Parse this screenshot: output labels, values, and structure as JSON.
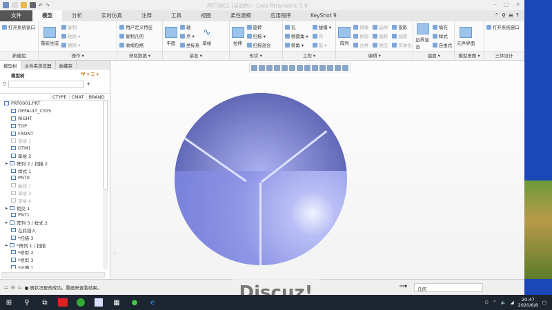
{
  "window": {
    "title": "PRT0001 (活动的) - Creo Parametric 5.0"
  },
  "tabs": [
    "文件",
    "模型",
    "分析",
    "实时仿真",
    "注释",
    "工具",
    "视图",
    "柔性建模",
    "应用程序",
    "KeyShot 9"
  ],
  "ribbon": {
    "groups": [
      {
        "label": "新建组",
        "items": [
          "打开系统窗口"
        ]
      },
      {
        "label": "操作 ▾",
        "big": "重新生成",
        "items": [
          "复制",
          "粘贴 ▾",
          "删除 ▾"
        ]
      },
      {
        "label": "获取数据 ▾",
        "items": [
          "用户定义特征",
          "复制几何",
          "收缩包络"
        ]
      },
      {
        "label": "基准 ▾",
        "big": "平面",
        "items": [
          "轴",
          "点 ▾",
          "坐标系"
        ],
        "big2": "草绘"
      },
      {
        "label": "形状 ▾",
        "big": "拉伸",
        "items": [
          "旋转",
          "扫描 ▾",
          "扫描混合"
        ]
      },
      {
        "label": "工程 ▾",
        "items": [
          "孔",
          "倒圆角 ▾",
          "倒角 ▾",
          "拔模 ▾",
          "壳",
          "筋 ▾"
        ]
      },
      {
        "label": "编辑 ▾",
        "big": "阵列",
        "items": [
          "镜像",
          "修剪",
          "合并",
          "延伸",
          "偏移",
          "相交",
          "投影",
          "加厚",
          "实体化"
        ]
      },
      {
        "label": "曲面 ▾",
        "big": "边界混合",
        "items": [
          "填充",
          "样式",
          "自由式"
        ]
      },
      {
        "label": "模型意图 ▾",
        "big": "元件界面",
        "items": []
      },
      {
        "label": "三体设计",
        "items": [
          "打开系统窗口"
        ]
      }
    ]
  },
  "panel": {
    "tabs": [
      "模型树",
      "文件夹浏览器",
      "收藏夹"
    ],
    "title": "模型树",
    "columns": [
      "CTYPE",
      "CMAT",
      "BRAND"
    ],
    "tree": [
      {
        "label": "PRT0001.PRT",
        "dis": false
      },
      {
        "label": "DEFAULT_CSYS",
        "dis": false
      },
      {
        "label": "RIGHT",
        "dis": false
      },
      {
        "label": "TOP",
        "dis": false
      },
      {
        "label": "FRONT",
        "dis": false
      },
      {
        "label": "草绘 1",
        "dis": true
      },
      {
        "label": "DTM1",
        "dis": false
      },
      {
        "label": "草绘 2",
        "dis": false
      },
      {
        "label": "阵列 2 / 扫描 2",
        "dis": false
      },
      {
        "label": "样式 1",
        "dis": false
      },
      {
        "label": "PNT0",
        "dis": false
      },
      {
        "label": "曲线 1",
        "dis": true
      },
      {
        "label": "草绘 3",
        "dis": true
      },
      {
        "label": "草绘 4",
        "dis": true
      },
      {
        "label": "相交 1",
        "dis": false
      },
      {
        "label": "PNT1",
        "dis": false
      },
      {
        "label": "阵列 3 / 样式 2",
        "dis": false
      },
      {
        "label": "在此插入",
        "dis": false
      },
      {
        "label": "*扫描 3",
        "dis": false
      },
      {
        "label": "*阵列 1 / 扫描",
        "dis": false
      },
      {
        "label": "*修剪 2",
        "dis": false
      },
      {
        "label": "*修剪 3",
        "dis": false
      },
      {
        "label": "*拉伸 1",
        "dis": false
      }
    ]
  },
  "status": {
    "message": "● 居状况更改成功。重画来查看结果。",
    "filter": "几何"
  },
  "taskbar": {
    "time": "20:47",
    "date": "2020/6/8"
  },
  "watermark": "Discuz!"
}
